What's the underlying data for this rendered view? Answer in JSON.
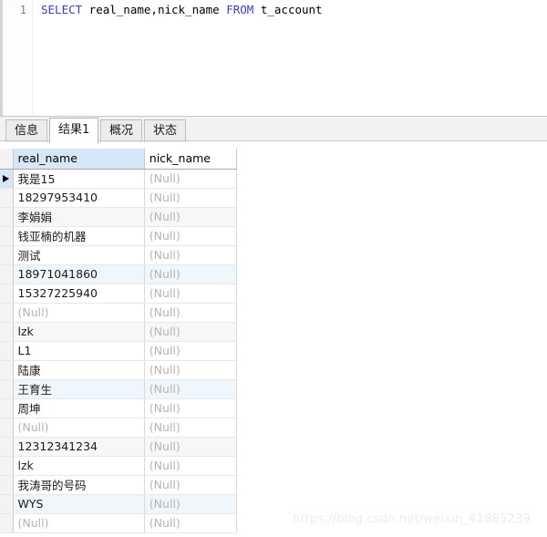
{
  "editor": {
    "line_number": "1",
    "sql_tokens": [
      {
        "text": "SELECT",
        "type": "keyword"
      },
      {
        "text": " real_name,nick_name ",
        "type": "identifier"
      },
      {
        "text": "FROM",
        "type": "keyword"
      },
      {
        "text": " t_account",
        "type": "identifier"
      }
    ],
    "sql_full": "SELECT real_name,nick_name FROM t_account"
  },
  "tabs": [
    {
      "label": "信息",
      "active": false
    },
    {
      "label": "结果1",
      "active": true
    },
    {
      "label": "概况",
      "active": false
    },
    {
      "label": "状态",
      "active": false
    }
  ],
  "result_grid": {
    "columns": [
      "real_name",
      "nick_name"
    ],
    "selected_column": "real_name",
    "current_row_index": 0,
    "null_text": "(Null)",
    "rows": [
      {
        "real_name": "我是15",
        "nick_name": "(Null)",
        "real_is_null": false,
        "stripe": "white",
        "highlight": false
      },
      {
        "real_name": "18297953410",
        "nick_name": "(Null)",
        "real_is_null": false,
        "stripe": "white",
        "highlight": false
      },
      {
        "real_name": "李娟娟",
        "nick_name": "(Null)",
        "real_is_null": false,
        "stripe": "alt",
        "highlight": false
      },
      {
        "real_name": "钱亚楠的机器",
        "nick_name": "(Null)",
        "real_is_null": false,
        "stripe": "white",
        "highlight": false
      },
      {
        "real_name": "测试",
        "nick_name": "(Null)",
        "real_is_null": false,
        "stripe": "white",
        "highlight": false
      },
      {
        "real_name": "18971041860",
        "nick_name": "(Null)",
        "real_is_null": false,
        "stripe": "white",
        "highlight": true
      },
      {
        "real_name": "15327225940",
        "nick_name": "(Null)",
        "real_is_null": false,
        "stripe": "white",
        "highlight": false
      },
      {
        "real_name": "(Null)",
        "nick_name": "(Null)",
        "real_is_null": true,
        "stripe": "white",
        "highlight": false
      },
      {
        "real_name": "lzk",
        "nick_name": "(Null)",
        "real_is_null": false,
        "stripe": "alt",
        "highlight": false
      },
      {
        "real_name": "L1",
        "nick_name": "(Null)",
        "real_is_null": false,
        "stripe": "white",
        "highlight": false
      },
      {
        "real_name": "陆康",
        "nick_name": "(Null)",
        "real_is_null": false,
        "stripe": "white",
        "highlight": false
      },
      {
        "real_name": "王育生",
        "nick_name": "(Null)",
        "real_is_null": false,
        "stripe": "white",
        "highlight": true
      },
      {
        "real_name": "周坤",
        "nick_name": "(Null)",
        "real_is_null": false,
        "stripe": "white",
        "highlight": false
      },
      {
        "real_name": "(Null)",
        "nick_name": "(Null)",
        "real_is_null": true,
        "stripe": "white",
        "highlight": false
      },
      {
        "real_name": "12312341234",
        "nick_name": "(Null)",
        "real_is_null": false,
        "stripe": "alt",
        "highlight": false
      },
      {
        "real_name": "lzk",
        "nick_name": "(Null)",
        "real_is_null": false,
        "stripe": "white",
        "highlight": false
      },
      {
        "real_name": "我涛哥的号码",
        "nick_name": "(Null)",
        "real_is_null": false,
        "stripe": "white",
        "highlight": false
      },
      {
        "real_name": "WYS",
        "nick_name": "(Null)",
        "real_is_null": false,
        "stripe": "white",
        "highlight": true
      },
      {
        "real_name": "(Null)",
        "nick_name": "(Null)",
        "real_is_null": true,
        "stripe": "white",
        "highlight": false
      }
    ]
  },
  "watermark": {
    "text": "https://blog.csdn.net/weixin_41885239"
  },
  "colors": {
    "keyword": "#3b3bc8",
    "null_text": "#b4b4b4",
    "selected_header": "#d6e8f7",
    "highlight_row": "#eff6fc",
    "alt_row": "#f7f7f7"
  }
}
